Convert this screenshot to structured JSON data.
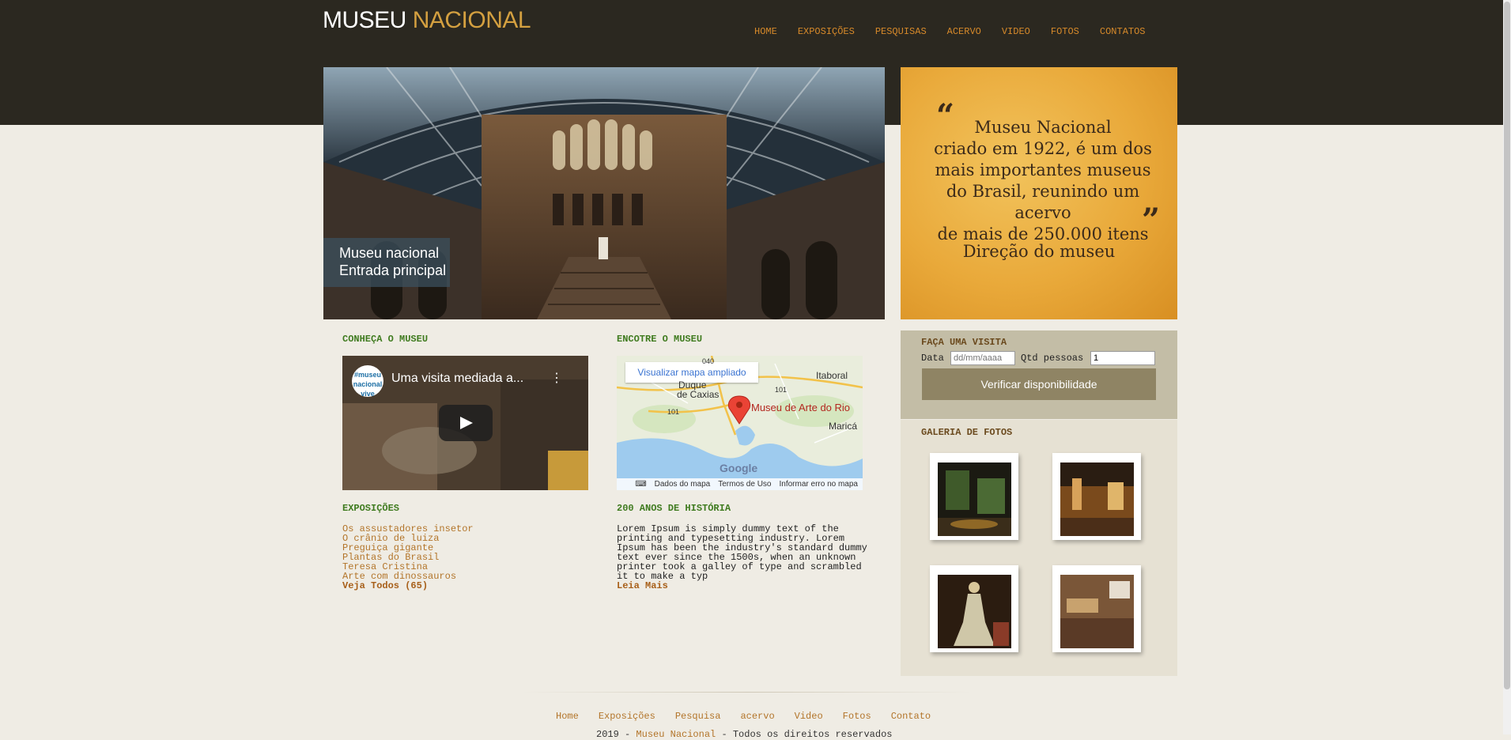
{
  "header": {
    "logo_main": "MUSEU",
    "logo_accent": "NACIONAL",
    "nav": [
      "HOME",
      "EXPOSIÇÕES",
      "PESQUISAS",
      "ACERVO",
      "VIDEO",
      "FOTOS",
      "CONTATOS"
    ]
  },
  "hero": {
    "caption_line1": "Museu nacional",
    "caption_line2": "Entrada principal"
  },
  "quote": {
    "open_mark": "“",
    "close_mark": "”",
    "lines": [
      "Museu Nacional",
      "criado em 1922, é um dos",
      "mais importantes museus",
      "do Brasil, reunindo um acervo",
      "de mais de 250.000 itens"
    ],
    "signature": "Direção do museu"
  },
  "sections": {
    "conheca_title": "CONHEÇA O MUSEU",
    "encontre_title": "ENCOTRE O MUSEU",
    "exposicoes_title": "EXPOSIÇÕES",
    "historia_title": "200 ANOS DE HISTÓRIA"
  },
  "video": {
    "title": "Uma visita mediada a...",
    "channel_logo": "#museu nacional vive"
  },
  "map": {
    "expand_button": "Visualizar mapa ampliado",
    "labels": {
      "duque": "Duque",
      "caxias": "de Caxias",
      "itaboral": "Itaboral",
      "marica": "Maricá",
      "r040": "040",
      "r101a": "101",
      "r101b": "101"
    },
    "place": "Museu de Arte do Rio",
    "brand": "Google",
    "footer": [
      "Dados do mapa",
      "Termos de Uso",
      "Informar erro no mapa"
    ]
  },
  "exposicoes": {
    "items": [
      "Os assustadores insetor",
      "O crânio de luiza",
      "Preguiça gigante",
      "Plantas do Brasil",
      "Teresa Cristina",
      "Arte com dinossauros"
    ],
    "more": "Veja Todos (65)"
  },
  "historia": {
    "text": "Lorem Ipsum is simply dummy text of the printing and typesetting industry. Lorem Ipsum has been the industry's standard dummy text ever since the 1500s, when an unknown printer took a galley of type and scrambled it to make a typ",
    "more": "Leia Mais"
  },
  "visita": {
    "title": "FAÇA UMA VISITA",
    "date_label": "Data",
    "date_placeholder": "dd/mm/aaaa",
    "qty_label": "Qtd pessoas",
    "qty_value": "1",
    "button": "Verificar disponibilidade"
  },
  "galeria": {
    "title": "GALERIA DE FOTOS"
  },
  "footer": {
    "nav": [
      "Home",
      "Exposições",
      "Pesquisa",
      "acervo",
      "Video",
      "Fotos",
      "Contato"
    ],
    "copy_year": "2019 -",
    "copy_site": "Museu Nacional",
    "copy_rest": "- Todos os direitos reservados"
  },
  "colors": {
    "header_bg": "#2b2820",
    "accent": "#d6892a",
    "section_green": "#3f7b1f",
    "link_brown": "#b3752a"
  }
}
